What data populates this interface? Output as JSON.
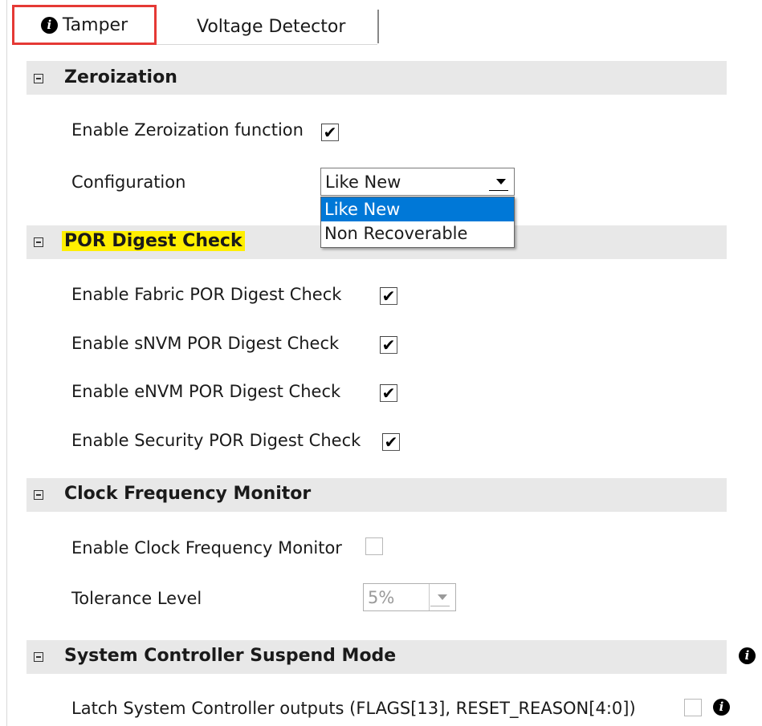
{
  "tabs": {
    "tamper": "Tamper",
    "voltage_detector": "Voltage Detector"
  },
  "info_glyph": "i",
  "zeroization": {
    "title": "Zeroization",
    "enable_label": "Enable Zeroization function",
    "enable_checked": true,
    "config_label": "Configuration",
    "config_value": "Like New",
    "options": [
      "Like New",
      "Non Recoverable"
    ]
  },
  "por": {
    "title": "POR Digest Check",
    "fabric": "Enable Fabric POR Digest Check",
    "snvm": "Enable sNVM POR Digest Check",
    "envm": "Enable eNVM POR Digest Check",
    "security": "Enable Security POR Digest Check"
  },
  "clock": {
    "title": "Clock Frequency Monitor",
    "enable_label": "Enable Clock Frequency Monitor",
    "enable_checked": false,
    "tolerance_label": "Tolerance Level",
    "tolerance_value": "5%"
  },
  "suspend": {
    "title": "System Controller Suspend Mode",
    "latch_label": "Latch System Controller outputs (FLAGS[13], RESET_REASON[4:0])",
    "latch_checked": false
  },
  "check_glyph": "✔",
  "colors": {
    "active_tab_border": "#e53935",
    "section_bg": "#e8e8e8",
    "highlight": "#ffef00",
    "selection": "#0078d7"
  }
}
